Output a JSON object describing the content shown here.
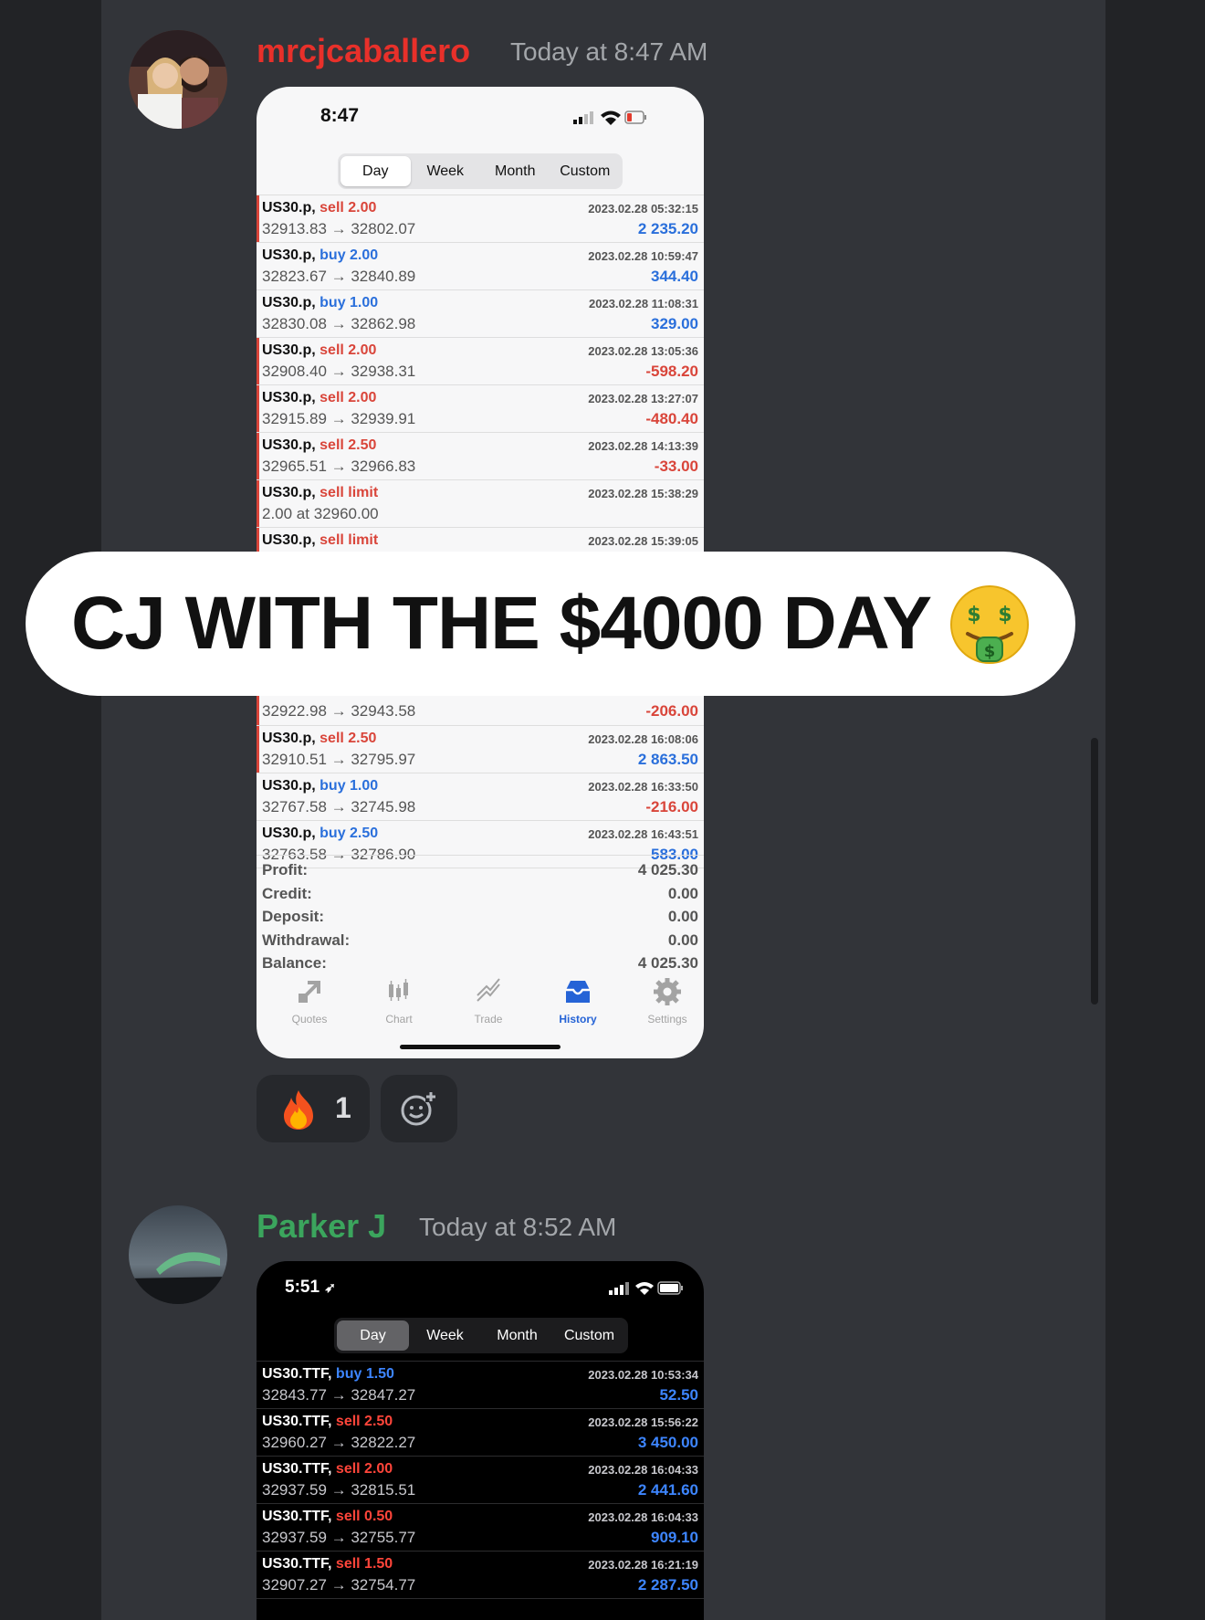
{
  "messages": [
    {
      "username": "mrcjcaballero",
      "username_color": "#e8302a",
      "timestamp": "Today at 8:47 AM",
      "phone": {
        "time": "8:47",
        "tabs": [
          "Day",
          "Week",
          "Month",
          "Custom"
        ],
        "selected_tab": "Day",
        "trades": [
          {
            "symbol": "US30.p,",
            "side": "sell 2.00",
            "side_color": "#d9453a",
            "prices": "32913.83 → 32802.07",
            "date": "2023.02.28 05:32:15",
            "profit": "2 235.20",
            "profit_color": "#2a6fdb"
          },
          {
            "symbol": "US30.p,",
            "side": "buy 2.00",
            "side_color": "#2a6fdb",
            "prices": "32823.67 → 32840.89",
            "date": "2023.02.28 10:59:47",
            "profit": "344.40",
            "profit_color": "#2a6fdb"
          },
          {
            "symbol": "US30.p,",
            "side": "buy 1.00",
            "side_color": "#2a6fdb",
            "prices": "32830.08 → 32862.98",
            "date": "2023.02.28 11:08:31",
            "profit": "329.00",
            "profit_color": "#2a6fdb"
          },
          {
            "symbol": "US30.p,",
            "side": "sell 2.00",
            "side_color": "#d9453a",
            "prices": "32908.40 → 32938.31",
            "date": "2023.02.28 13:05:36",
            "profit": "-598.20",
            "profit_color": "#d9453a"
          },
          {
            "symbol": "US30.p,",
            "side": "sell 2.00",
            "side_color": "#d9453a",
            "prices": "32915.89 → 32939.91",
            "date": "2023.02.28 13:27:07",
            "profit": "-480.40",
            "profit_color": "#d9453a"
          },
          {
            "symbol": "US30.p,",
            "side": "sell 2.50",
            "side_color": "#d9453a",
            "prices": "32965.51 → 32966.83",
            "date": "2023.02.28 14:13:39",
            "profit": "-33.00",
            "profit_color": "#d9453a"
          },
          {
            "symbol": "US30.p,",
            "side": "sell limit",
            "side_color": "#d9453a",
            "prices": "2.00 at 32960.00",
            "date": "2023.02.28 15:38:29",
            "profit": "",
            "profit_color": "#2a6fdb"
          },
          {
            "symbol": "US30.p,",
            "side": "sell limit",
            "side_color": "#d9453a",
            "prices": "",
            "date": "2023.02.28 15:39:05",
            "profit": "",
            "profit_color": "#2a6fdb"
          }
        ],
        "trades_after": [
          {
            "symbol": "",
            "side": "",
            "side_color": "#d9453a",
            "prices": "32922.98 → 32943.58",
            "date": "",
            "profit": "-206.00",
            "profit_color": "#d9453a"
          },
          {
            "symbol": "US30.p,",
            "side": "sell 2.50",
            "side_color": "#d9453a",
            "prices": "32910.51 → 32795.97",
            "date": "2023.02.28 16:08:06",
            "profit": "2 863.50",
            "profit_color": "#2a6fdb"
          },
          {
            "symbol": "US30.p,",
            "side": "buy 1.00",
            "side_color": "#2a6fdb",
            "prices": "32767.58 → 32745.98",
            "date": "2023.02.28 16:33:50",
            "profit": "-216.00",
            "profit_color": "#d9453a"
          },
          {
            "symbol": "US30.p,",
            "side": "buy 2.50",
            "side_color": "#2a6fdb",
            "prices": "32763.58 → 32786.90",
            "date": "2023.02.28 16:43:51",
            "profit": "583.00",
            "profit_color": "#2a6fdb"
          }
        ],
        "summary": [
          {
            "label": "Profit:",
            "value": "4 025.30"
          },
          {
            "label": "Credit:",
            "value": "0.00"
          },
          {
            "label": "Deposit:",
            "value": "0.00"
          },
          {
            "label": "Withdrawal:",
            "value": "0.00"
          },
          {
            "label": "Balance:",
            "value": "4 025.30"
          }
        ],
        "nav": [
          "Quotes",
          "Chart",
          "Trade",
          "History",
          "Settings"
        ],
        "active_nav": "History"
      },
      "reactions": [
        {
          "emoji": "fire",
          "count": "1"
        }
      ]
    },
    {
      "username": "Parker J",
      "username_color": "#3ba55d",
      "timestamp": "Today at 8:52 AM",
      "phone": {
        "time": "5:51",
        "tabs": [
          "Day",
          "Week",
          "Month",
          "Custom"
        ],
        "selected_tab": "Day",
        "trades": [
          {
            "symbol": "US30.TTF,",
            "side": "buy 1.50",
            "side_color": "#3d85ff",
            "prices": "32843.77 → 32847.27",
            "date": "2023.02.28 10:53:34",
            "profit": "52.50",
            "profit_color": "#3d85ff"
          },
          {
            "symbol": "US30.TTF,",
            "side": "sell 2.50",
            "side_color": "#ff453a",
            "prices": "32960.27 → 32822.27",
            "date": "2023.02.28 15:56:22",
            "profit": "3 450.00",
            "profit_color": "#3d85ff"
          },
          {
            "symbol": "US30.TTF,",
            "side": "sell 2.00",
            "side_color": "#ff453a",
            "prices": "32937.59 → 32815.51",
            "date": "2023.02.28 16:04:33",
            "profit": "2 441.60",
            "profit_color": "#3d85ff"
          },
          {
            "symbol": "US30.TTF,",
            "side": "sell 0.50",
            "side_color": "#ff453a",
            "prices": "32937.59 → 32755.77",
            "date": "2023.02.28 16:04:33",
            "profit": "909.10",
            "profit_color": "#3d85ff"
          },
          {
            "symbol": "US30.TTF,",
            "side": "sell 1.50",
            "side_color": "#ff453a",
            "prices": "32907.27 → 32754.77",
            "date": "2023.02.28 16:21:19",
            "profit": "2 287.50",
            "profit_color": "#3d85ff"
          }
        ]
      }
    }
  ],
  "overlay": {
    "text": "CJ WITH THE $4000 DAY",
    "emoji": "money-mouth-face"
  },
  "icons": {
    "reaction": "fire-icon",
    "add_reaction": "add-reaction-icon"
  }
}
